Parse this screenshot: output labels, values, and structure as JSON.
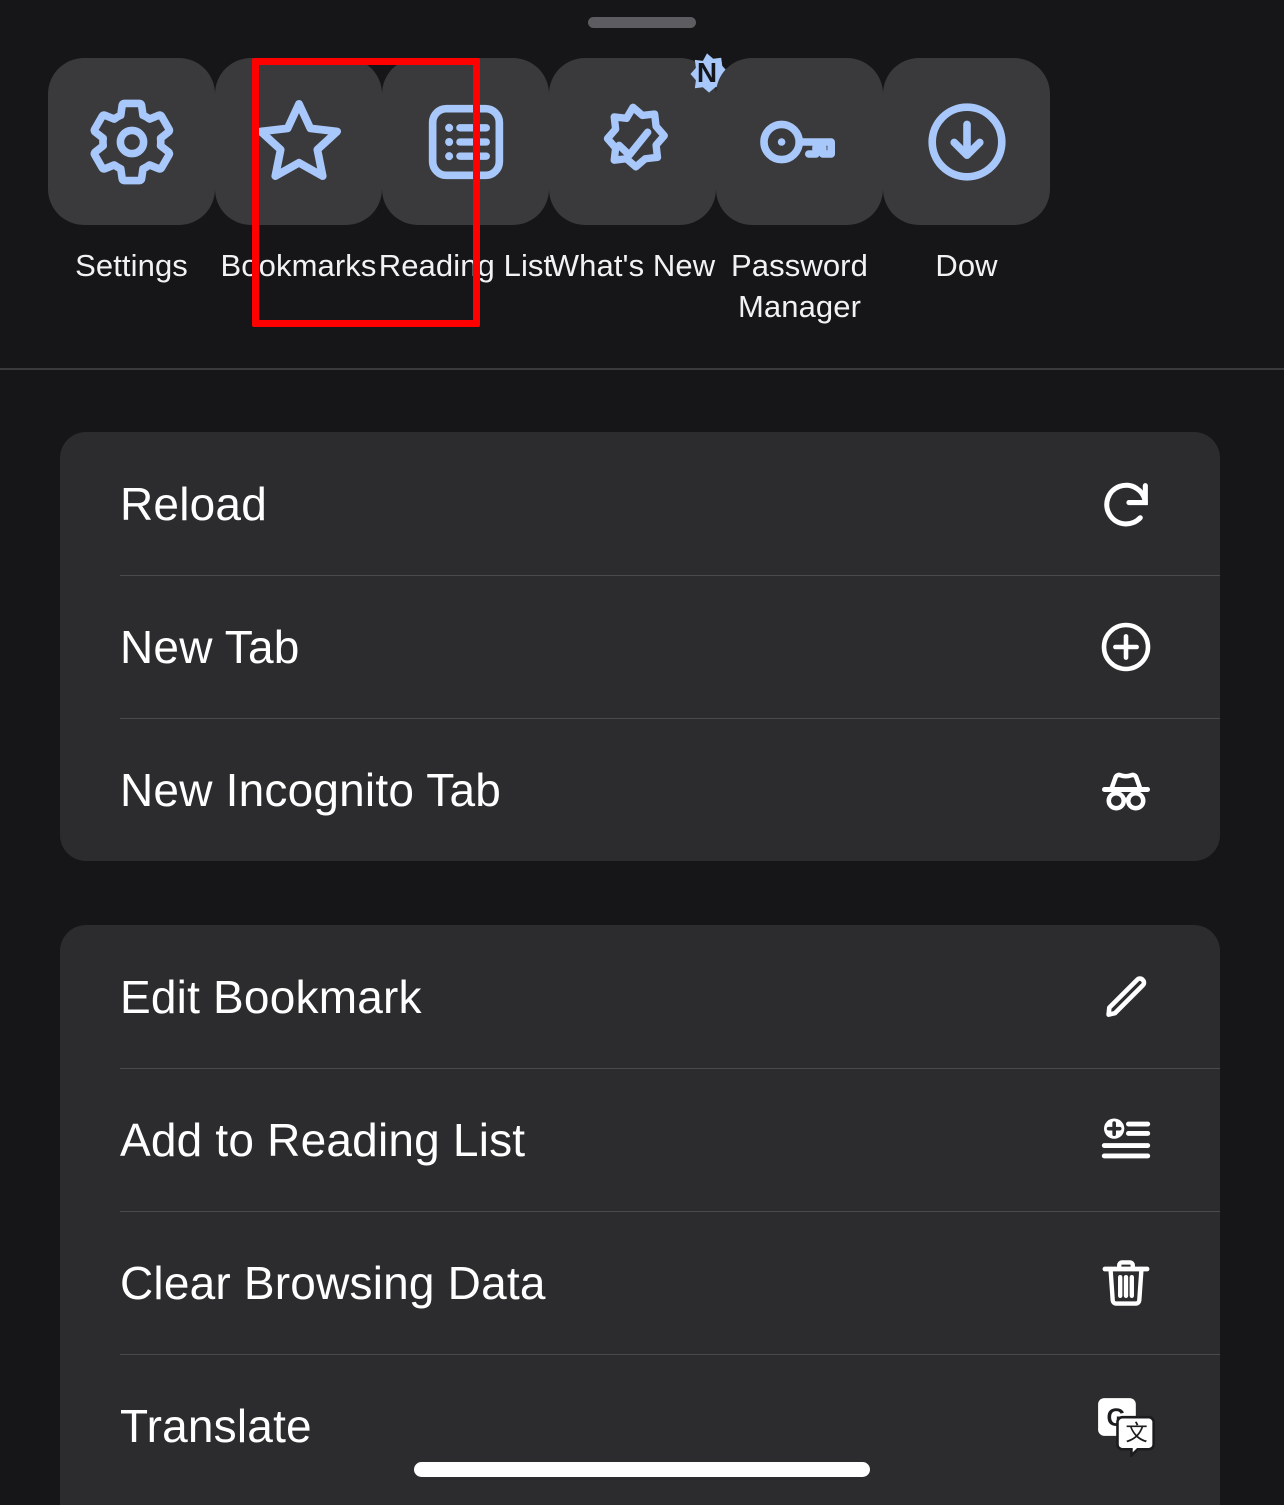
{
  "sheet": {
    "background_color": "#161618",
    "card_color": "#2c2c2e",
    "tile_color": "#3a3a3c",
    "accent_color": "#a8c7fa",
    "annotation_color": "#ff0000",
    "grabber_name": "drag-handle"
  },
  "shortcuts": [
    {
      "label": "Settings",
      "icon": "gear-icon",
      "badge": null,
      "highlighted": false
    },
    {
      "label": "Bookmarks",
      "icon": "star-icon",
      "badge": null,
      "highlighted": true
    },
    {
      "label": "Reading List",
      "icon": "list-box-icon",
      "badge": null,
      "highlighted": false
    },
    {
      "label": "What's New",
      "icon": "badge-check-icon",
      "badge": "N",
      "highlighted": false
    },
    {
      "label": "Password Manager",
      "icon": "key-icon",
      "badge": null,
      "highlighted": false
    },
    {
      "label": "Dow",
      "icon": "download-circle-icon",
      "badge": null,
      "highlighted": false
    }
  ],
  "menu_groups": [
    {
      "name": "page-actions",
      "items": [
        {
          "label": "Reload",
          "icon": "reload-icon"
        },
        {
          "label": "New Tab",
          "icon": "plus-circle-icon"
        },
        {
          "label": "New Incognito Tab",
          "icon": "incognito-icon"
        }
      ]
    },
    {
      "name": "tools",
      "items": [
        {
          "label": "Edit Bookmark",
          "icon": "pencil-icon"
        },
        {
          "label": "Add to Reading List",
          "icon": "add-to-list-icon"
        },
        {
          "label": "Clear Browsing Data",
          "icon": "trash-icon"
        },
        {
          "label": "Translate",
          "icon": "google-translate-icon"
        }
      ]
    }
  ],
  "home_indicator": {
    "name": "home-indicator"
  }
}
